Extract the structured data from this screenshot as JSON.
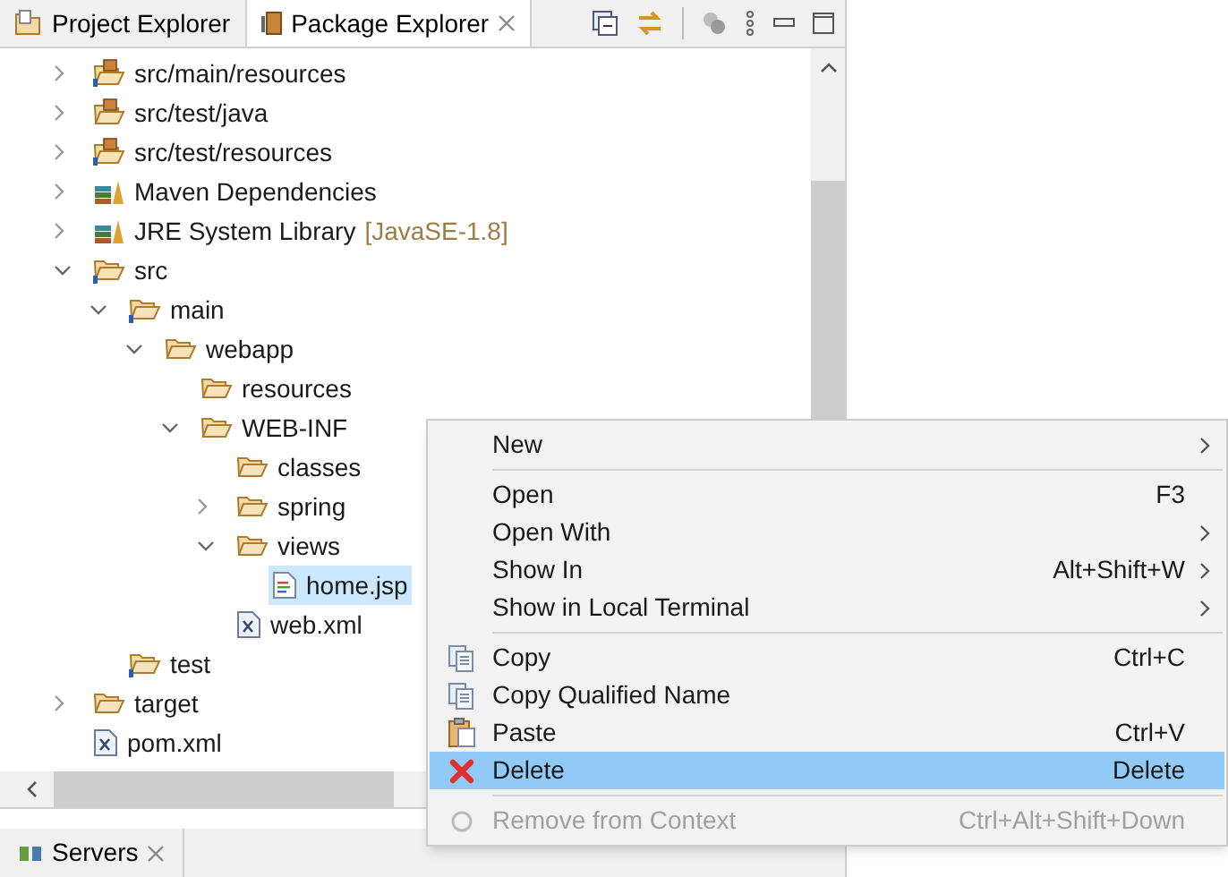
{
  "tabs": [
    {
      "label": "Project Explorer",
      "selected": false,
      "closable": false
    },
    {
      "label": "Package Explorer",
      "selected": true,
      "closable": true
    }
  ],
  "tree": [
    {
      "label": "src/main/resources",
      "kind": "source-folder",
      "expanded": false,
      "selected": false
    },
    {
      "label": "src/test/java",
      "kind": "package-folder",
      "expanded": false,
      "selected": false
    },
    {
      "label": "src/test/resources",
      "kind": "source-folder",
      "expanded": false,
      "selected": false
    },
    {
      "label": "Maven Dependencies",
      "kind": "library",
      "expanded": false,
      "selected": false
    },
    {
      "label": "JRE System Library",
      "decoration": "[JavaSE-1.8]",
      "kind": "library",
      "expanded": false,
      "selected": false
    },
    {
      "label": "src",
      "kind": "info-folder",
      "expanded": true,
      "selected": false,
      "children": [
        {
          "label": "main",
          "kind": "info-folder",
          "expanded": true,
          "selected": false,
          "children": [
            {
              "label": "webapp",
              "kind": "folder",
              "expanded": true,
              "selected": false,
              "children": [
                {
                  "label": "resources",
                  "kind": "folder",
                  "selected": false
                },
                {
                  "label": "WEB-INF",
                  "kind": "folder",
                  "expanded": true,
                  "selected": false,
                  "children": [
                    {
                      "label": "classes",
                      "kind": "folder",
                      "selected": false
                    },
                    {
                      "label": "spring",
                      "kind": "folder",
                      "expanded": false,
                      "selected": false
                    },
                    {
                      "label": "views",
                      "kind": "folder",
                      "expanded": true,
                      "selected": false,
                      "children": [
                        {
                          "label": "home.jsp",
                          "kind": "jsp-file",
                          "selected": true
                        }
                      ]
                    },
                    {
                      "label": "web.xml",
                      "kind": "xml-file",
                      "selected": false
                    }
                  ]
                }
              ]
            }
          ]
        },
        {
          "label": "test",
          "kind": "info-folder",
          "selected": false
        }
      ]
    },
    {
      "label": "target",
      "kind": "folder",
      "expanded": false,
      "selected": false
    },
    {
      "label": "pom.xml",
      "kind": "xml-file",
      "selected": false
    }
  ],
  "context_menu": [
    {
      "kind": "item",
      "label": "New",
      "submenu": true,
      "selected": false,
      "disabled": false
    },
    {
      "kind": "separator"
    },
    {
      "kind": "item",
      "label": "Open",
      "shortcut": "F3",
      "selected": false,
      "disabled": false
    },
    {
      "kind": "item",
      "label": "Open With",
      "submenu": true,
      "selected": false,
      "disabled": false
    },
    {
      "kind": "item",
      "label": "Show In",
      "shortcut": "Alt+Shift+W",
      "submenu": true,
      "selected": false,
      "disabled": false
    },
    {
      "kind": "item",
      "label": "Show in Local Terminal",
      "submenu": true,
      "selected": false,
      "disabled": false
    },
    {
      "kind": "separator"
    },
    {
      "kind": "item",
      "label": "Copy",
      "shortcut": "Ctrl+C",
      "selected": false,
      "disabled": false
    },
    {
      "kind": "item",
      "label": "Copy Qualified Name",
      "selected": false,
      "disabled": false
    },
    {
      "kind": "item",
      "label": "Paste",
      "shortcut": "Ctrl+V",
      "selected": false,
      "disabled": false
    },
    {
      "kind": "item",
      "label": "Delete",
      "shortcut": "Delete",
      "selected": true,
      "disabled": false
    },
    {
      "kind": "separator"
    },
    {
      "kind": "item",
      "label": "Remove from Context",
      "shortcut": "Ctrl+Alt+Shift+Down",
      "selected": false,
      "disabled": true
    }
  ],
  "bottom_tabs": [
    {
      "label": "Servers",
      "closable": true
    }
  ]
}
